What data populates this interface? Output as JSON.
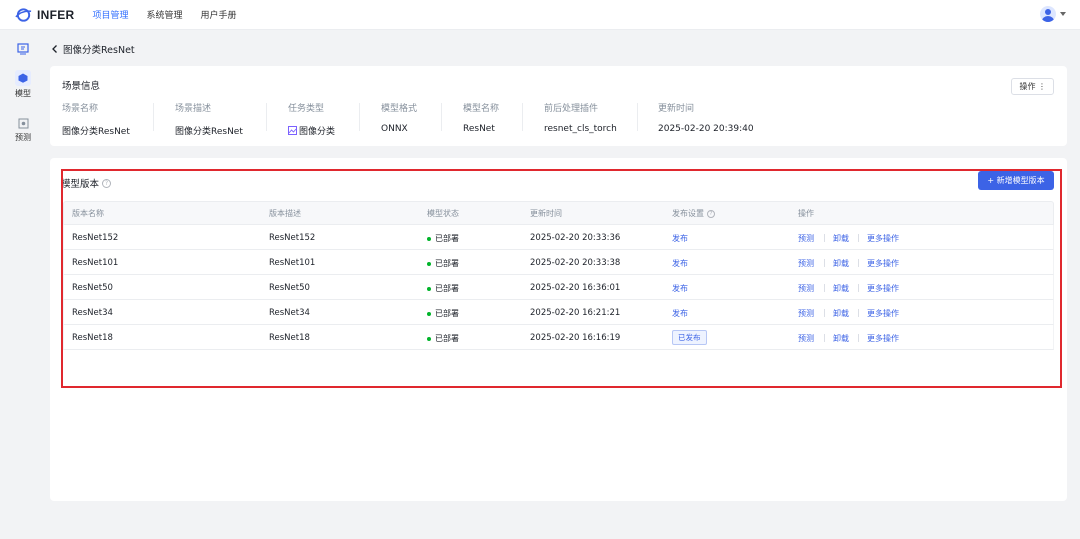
{
  "topbar": {
    "brand": "INFER",
    "nav": [
      {
        "label": "项目管理",
        "active": true
      },
      {
        "label": "系统管理",
        "active": false
      },
      {
        "label": "用户手册",
        "active": false
      }
    ]
  },
  "rail": {
    "items": [
      {
        "label": "",
        "icon": "scene-icon"
      },
      {
        "label": "模型",
        "icon": "cube-icon",
        "active": true
      },
      {
        "label": "预测",
        "icon": "target-icon"
      }
    ]
  },
  "breadcrumb": {
    "title": "图像分类ResNet"
  },
  "scene_info": {
    "title": "场景信息",
    "action_label": "操作 ⋮",
    "fields": [
      {
        "label": "场景名称",
        "value": "图像分类ResNet"
      },
      {
        "label": "场景描述",
        "value": "图像分类ResNet"
      },
      {
        "label": "任务类型",
        "value": "图像分类"
      },
      {
        "label": "模型格式",
        "value": "ONNX"
      },
      {
        "label": "模型名称",
        "value": "ResNet"
      },
      {
        "label": "前后处理插件",
        "value": "resnet_cls_torch"
      },
      {
        "label": "更新时间",
        "value": "2025-02-20 20:39:40"
      }
    ]
  },
  "versions": {
    "title": "模型版本",
    "add_label": "+ 新增模型版本",
    "columns": [
      "版本名称",
      "版本描述",
      "模型状态",
      "更新时间",
      "发布设置",
      "操作"
    ],
    "rows": [
      {
        "name": "ResNet152",
        "desc": "ResNet152",
        "status": "已部署",
        "time": "2025-02-20 20:33:36",
        "publish": "发布",
        "published": false
      },
      {
        "name": "ResNet101",
        "desc": "ResNet101",
        "status": "已部署",
        "time": "2025-02-20 20:33:38",
        "publish": "发布",
        "published": false
      },
      {
        "name": "ResNet50",
        "desc": "ResNet50",
        "status": "已部署",
        "time": "2025-02-20 16:36:01",
        "publish": "发布",
        "published": false
      },
      {
        "name": "ResNet34",
        "desc": "ResNet34",
        "status": "已部署",
        "time": "2025-02-20 16:21:21",
        "publish": "发布",
        "published": false
      },
      {
        "name": "ResNet18",
        "desc": "ResNet18",
        "status": "已部署",
        "time": "2025-02-20 16:16:19",
        "publish": "已发布",
        "published": true
      }
    ],
    "actions": [
      "预测",
      "卸载",
      "更多操作"
    ]
  },
  "colors": {
    "accent": "#3c63e6",
    "status_ok": "#00b42a",
    "highlight": "#e0282e"
  }
}
